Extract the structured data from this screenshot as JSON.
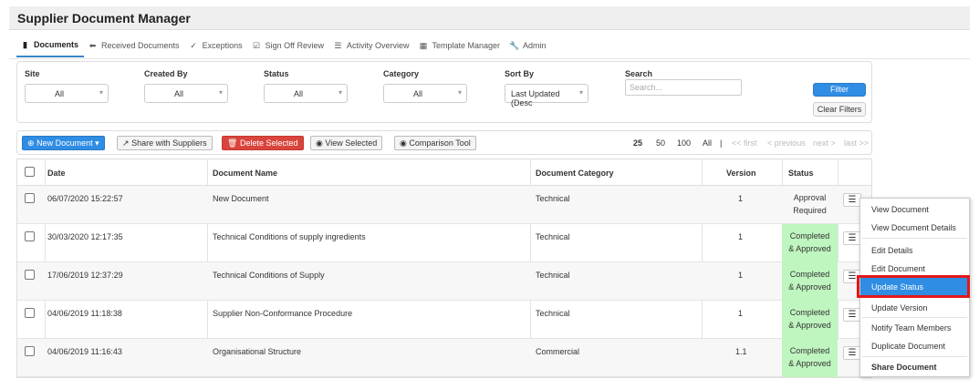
{
  "app": {
    "title": "Supplier Document Manager"
  },
  "nav": {
    "tabs": [
      {
        "label": "Documents",
        "icon": "document-icon"
      },
      {
        "label": "Received Documents",
        "icon": "arrow-left-icon"
      },
      {
        "label": "Exceptions",
        "icon": "circle-check-icon"
      },
      {
        "label": "Sign Off Review",
        "icon": "checkbox-edit-icon"
      },
      {
        "label": "Activity Overview",
        "icon": "list-icon"
      },
      {
        "label": "Template Manager",
        "icon": "template-icon"
      },
      {
        "label": "Admin",
        "icon": "wrench-icon"
      }
    ]
  },
  "filters": {
    "site": {
      "label": "Site",
      "value": "All"
    },
    "created_by": {
      "label": "Created By",
      "value": "All"
    },
    "status": {
      "label": "Status",
      "value": "All"
    },
    "category": {
      "label": "Category",
      "value": "All"
    },
    "sort_by": {
      "label": "Sort By",
      "value": "Last Updated (Desc"
    },
    "search": {
      "label": "Search",
      "placeholder": "Search..."
    },
    "filter_button": "Filter",
    "clear_button": "Clear Filters"
  },
  "toolbar": {
    "new_document": "New Document",
    "share_with_suppliers": "Share with Suppliers",
    "delete_selected": "Delete Selected",
    "view_selected": "View Selected",
    "comparison_tool": "Comparison Tool",
    "page_sizes": [
      "25",
      "50",
      "100",
      "All"
    ],
    "separator": "|",
    "pager": {
      "first": "<< first",
      "previous": "< previous",
      "next": "next >",
      "last": "last >>"
    }
  },
  "table": {
    "columns": [
      "Date",
      "Document Name",
      "Document Category",
      "Version",
      "Status"
    ],
    "rows": [
      {
        "date": "06/07/2020 15:22:57",
        "name": "New Document",
        "category": "Technical",
        "version": "1",
        "status_l1": "Approval",
        "status_l2": "Required",
        "approved": false
      },
      {
        "date": "30/03/2020 12:17:35",
        "name": "Technical Conditions of supply ingredients",
        "category": "Technical",
        "version": "1",
        "status_l1": "Completed",
        "status_l2": "& Approved",
        "approved": true
      },
      {
        "date": "17/06/2019 12:37:29",
        "name": "Technical Conditions of Supply",
        "category": "Technical",
        "version": "1",
        "status_l1": "Completed",
        "status_l2": "& Approved",
        "approved": true
      },
      {
        "date": "04/06/2019 11:18:38",
        "name": "Supplier Non-Conformance Procedure",
        "category": "Technical",
        "version": "1",
        "status_l1": "Completed",
        "status_l2": "& Approved",
        "approved": true
      },
      {
        "date": "04/06/2019 11:16:43",
        "name": "Organisational Structure",
        "category": "Commercial",
        "version": "1.1",
        "status_l1": "Completed",
        "status_l2": "& Approved",
        "approved": true
      }
    ]
  },
  "context_menu": {
    "items": [
      "View Document",
      "View Document Details",
      "Edit Details",
      "Edit Document",
      "Update Status",
      "Update Version",
      "Notify Team Members",
      "Duplicate Document",
      "Share Document"
    ],
    "selected": "Update Status",
    "highlight_color": "#e4171b"
  },
  "colors": {
    "accent": "#2f8de4",
    "danger": "#d9443c",
    "approved_bg": "#bff5bf"
  }
}
